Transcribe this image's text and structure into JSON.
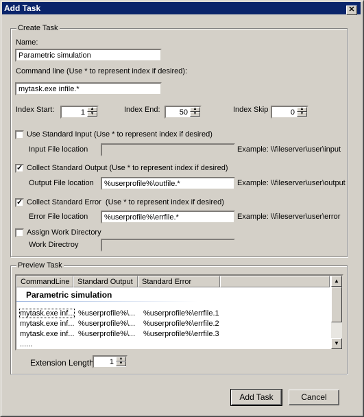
{
  "window": {
    "title": "Add Task",
    "close_icon": "close-icon"
  },
  "create": {
    "group_label": "Create Task",
    "name_label": "Name:",
    "name_value": "Parametric simulation",
    "cmd_label": "Command line (Use * to represent index if desired):",
    "cmd_value": "mytask.exe infile.*",
    "index_start_label": "Index Start:",
    "index_start": "1",
    "index_end_label": "Index End:",
    "index_end": "50",
    "index_skip_label": "Index Skip",
    "index_skip": "0",
    "std_input": {
      "label": "Use Standard Input (Use * to represent index if desired)",
      "checked": false,
      "field_label": "Input File location",
      "value": "",
      "example": "Example: \\\\fileserver\\user\\input"
    },
    "std_output": {
      "label": "Collect Standard Output (Use * to represent index if desired)",
      "checked": true,
      "field_label": "Output File location",
      "value": "%userprofile%\\outfile.*",
      "example": "Example: \\\\fileserver\\user\\output"
    },
    "std_error": {
      "label": "Collect Standard Error  (Use * to represent index if desired)",
      "checked": true,
      "field_label": "Error File location",
      "value": "%userprofile%\\errfile.*",
      "example": "Example: \\\\fileserver\\user\\error"
    },
    "work_dir": {
      "label": "Assign Work Directory",
      "checked": false,
      "field_label": "Work Directroy",
      "value": ""
    }
  },
  "preview": {
    "group_label": "Preview Task",
    "columns": [
      "CommandLine",
      "Standard Output",
      "Standard Error"
    ],
    "group_title": "Parametric simulation",
    "rows": [
      [
        "mytask.exe inf...",
        "%userprofile%\\...",
        "%userprofile%\\errfile.1"
      ],
      [
        "mytask.exe inf...",
        "%userprofile%\\...",
        "%userprofile%\\errfile.2"
      ],
      [
        "mytask.exe inf...",
        "%userprofile%\\...",
        "%userprofile%\\errfile.3"
      ]
    ],
    "ellipsis": "......",
    "ext_label": "Extension Length:",
    "ext_value": "1"
  },
  "buttons": {
    "add": "Add Task",
    "cancel": "Cancel"
  }
}
